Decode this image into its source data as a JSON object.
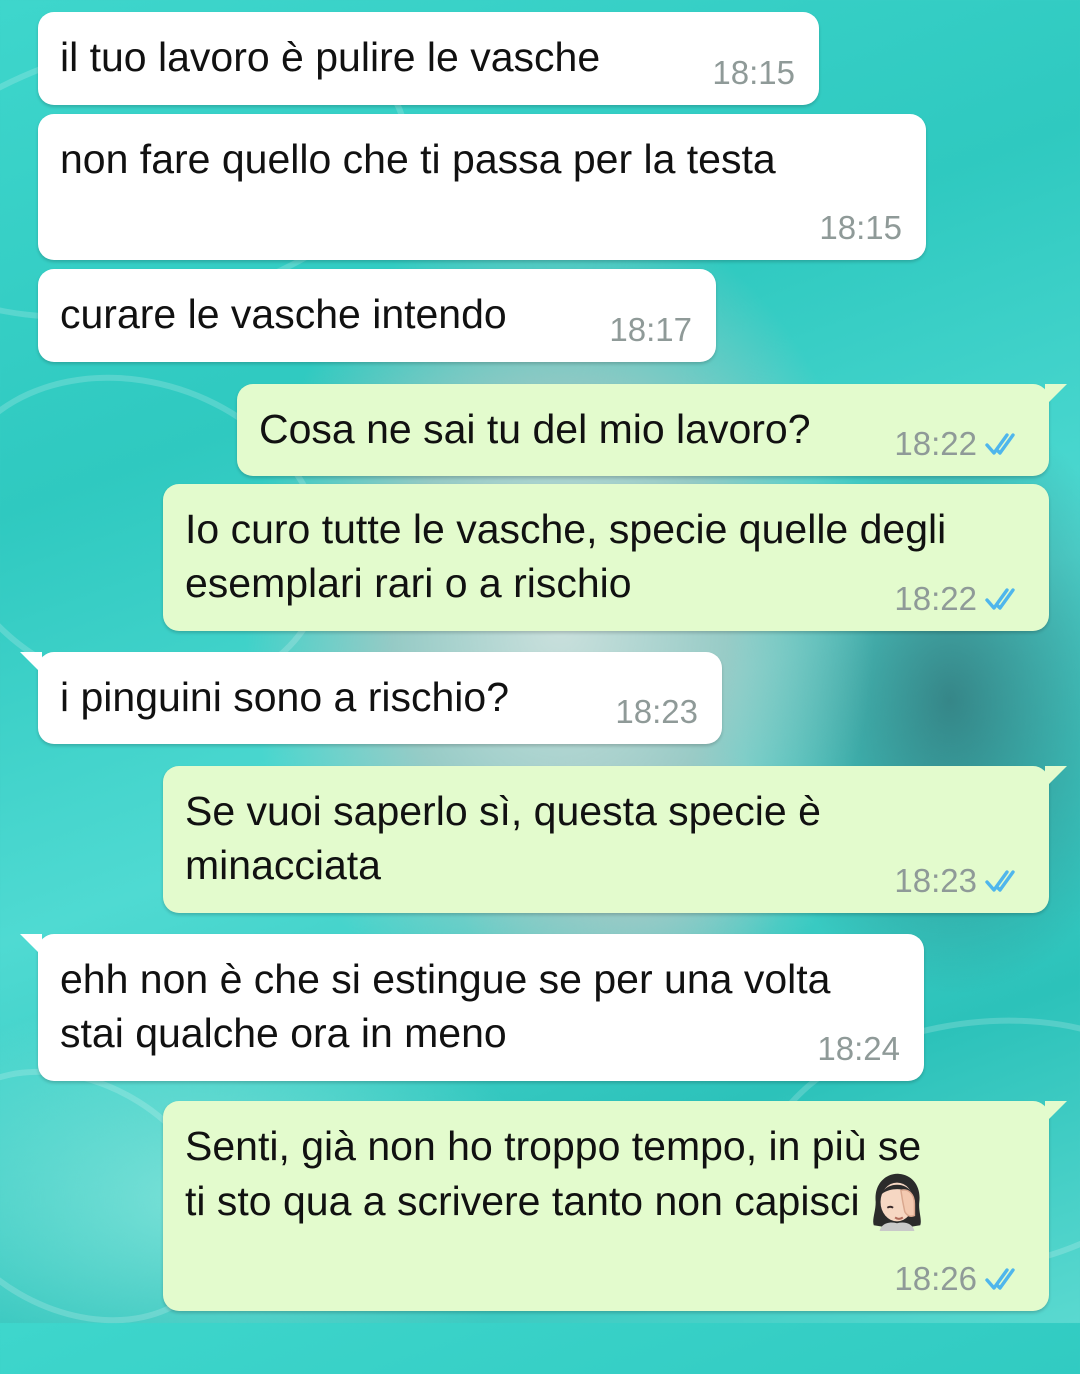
{
  "theme": {
    "incoming_bubble": "#ffffff",
    "outgoing_bubble": "#e3fbcd",
    "read_tick_color": "#4fb6ec",
    "timestamp_color": "#8f9a98"
  },
  "messages": [
    {
      "direction": "incoming",
      "text": "il tuo lavoro è pulire le vasche",
      "time": "18:15"
    },
    {
      "direction": "incoming",
      "text": "non fare quello che ti passa per la testa",
      "time": "18:15"
    },
    {
      "direction": "incoming",
      "text": "curare le vasche intendo",
      "time": "18:17"
    },
    {
      "direction": "outgoing",
      "text": "Cosa ne sai tu del mio lavoro?",
      "time": "18:22",
      "status": "read"
    },
    {
      "direction": "outgoing",
      "text": "Io curo tutte le vasche, specie quelle degli\nesemplari rari o a rischio",
      "time": "18:22",
      "status": "read"
    },
    {
      "direction": "incoming",
      "text": "i pinguini sono a rischio?",
      "time": "18:23"
    },
    {
      "direction": "outgoing",
      "text": "Se vuoi saperlo sì, questa specie è\nminacciata",
      "time": "18:23",
      "status": "read"
    },
    {
      "direction": "incoming",
      "text": "ehh non è che si estingue se per una volta\nstai qualche ora in meno",
      "time": "18:24"
    },
    {
      "direction": "outgoing",
      "text": "Senti, già non ho troppo tempo, in più se\nti sto qua a scrivere tanto non capisci",
      "time": "18:26",
      "status": "read",
      "emoji": "woman-facepalming-icon"
    }
  ]
}
